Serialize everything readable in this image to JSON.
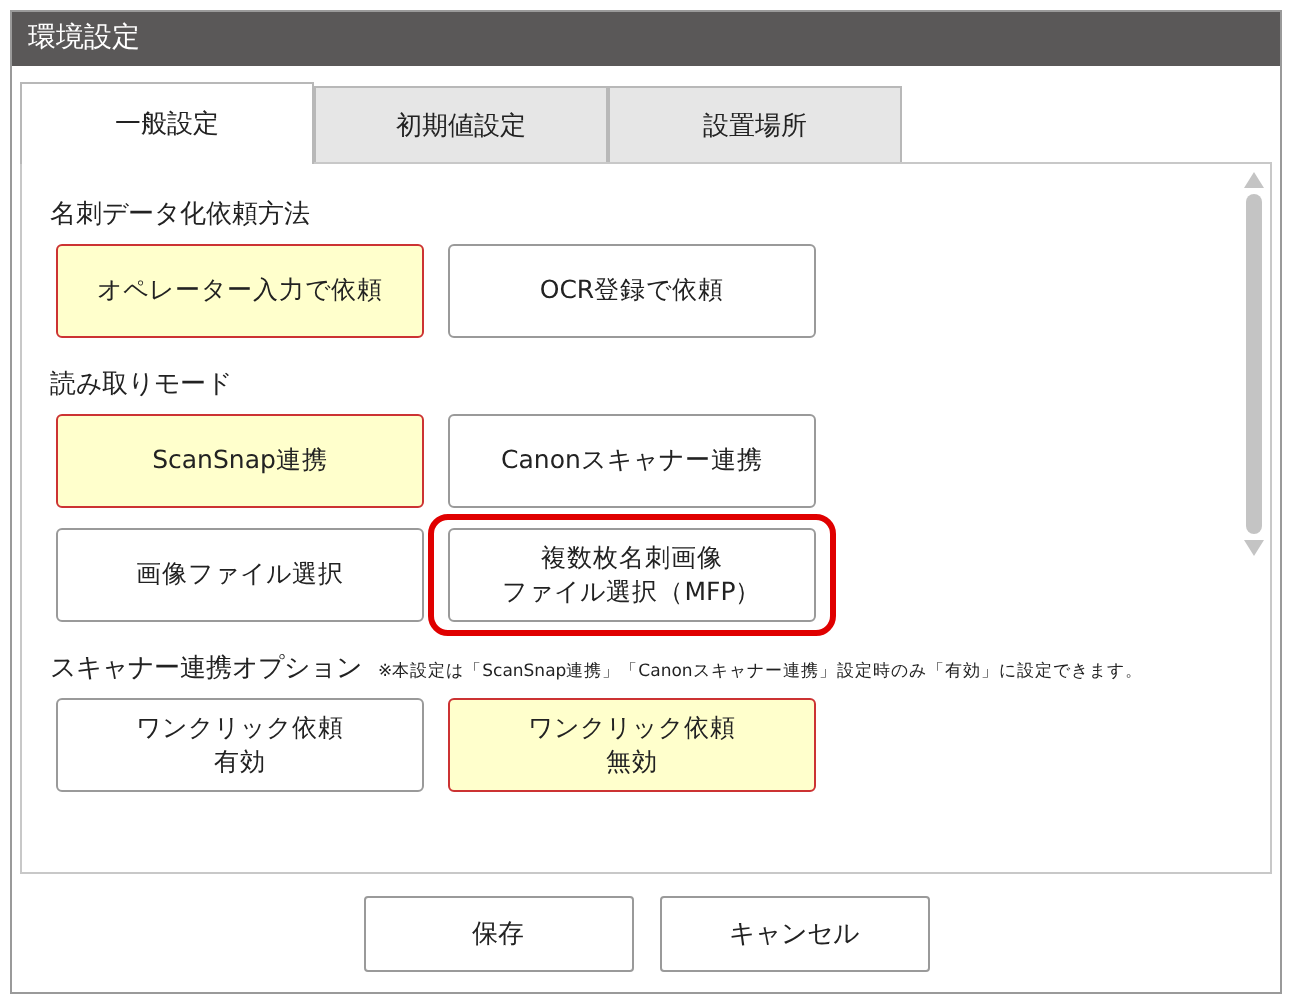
{
  "window": {
    "title": "環境設定"
  },
  "tabs": [
    {
      "label": "一般設定",
      "selected": true
    },
    {
      "label": "初期値設定",
      "selected": false
    },
    {
      "label": "設置場所",
      "selected": false
    }
  ],
  "sections": [
    {
      "title": "名刺データ化依頼方法",
      "rows": [
        [
          {
            "lines": [
              "オペレーター入力で依頼"
            ],
            "selected": true,
            "highlighted": false
          },
          {
            "lines": [
              "OCR登録で依頼"
            ],
            "selected": false,
            "highlighted": false
          }
        ]
      ]
    },
    {
      "title": "読み取りモード",
      "rows": [
        [
          {
            "lines": [
              "ScanSnap連携"
            ],
            "selected": true,
            "highlighted": false
          },
          {
            "lines": [
              "Canonスキャナー連携"
            ],
            "selected": false,
            "highlighted": false
          }
        ],
        [
          {
            "lines": [
              "画像ファイル選択"
            ],
            "selected": false,
            "highlighted": false
          },
          {
            "lines": [
              "複数枚名刺画像",
              "ファイル選択（MFP）"
            ],
            "selected": false,
            "highlighted": true
          }
        ]
      ]
    },
    {
      "title": "スキャナー連携オプション",
      "note": "※本設定は「ScanSnap連携」「Canonスキャナー連携」設定時のみ「有効」に設定できます。",
      "rows": [
        [
          {
            "lines": [
              "ワンクリック依頼",
              "有効"
            ],
            "selected": false,
            "highlighted": false
          },
          {
            "lines": [
              "ワンクリック依頼",
              "無効"
            ],
            "selected": true,
            "highlighted": false
          }
        ]
      ]
    }
  ],
  "buttons": [
    "保存",
    "キャンセル"
  ]
}
